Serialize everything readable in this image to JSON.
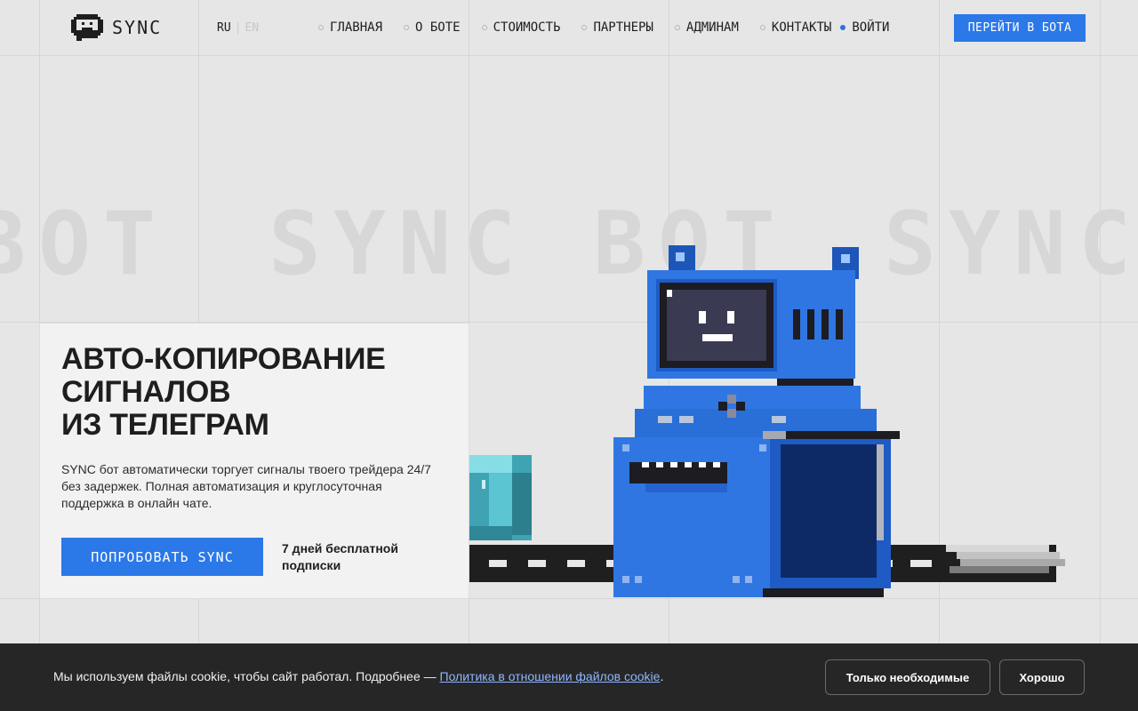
{
  "header": {
    "logo_text": "SYNC",
    "lang": {
      "ru": "RU",
      "separator": "|",
      "en": "EN"
    },
    "nav": [
      {
        "label": "ГЛАВНАЯ",
        "active": false
      },
      {
        "label": "О БОТЕ",
        "active": false
      },
      {
        "label": "СТОИМОСТЬ",
        "active": false
      },
      {
        "label": "ПАРТНЕРЫ",
        "active": false
      },
      {
        "label": "АДМИНАМ",
        "active": false
      },
      {
        "label": "КОНТАКТЫ",
        "active": false
      },
      {
        "label": "ВОЙТИ",
        "active": true
      }
    ],
    "cta": "ПЕРЕЙТИ В БОТА"
  },
  "watermark": {
    "text_left": "BOT",
    "text_center": "SYNC BOT",
    "text_right": "SYNC"
  },
  "hero": {
    "title_line1": "АВТО-КОПИРОВАНИЕ",
    "title_line2": "СИГНАЛОВ",
    "title_line3": "ИЗ ТЕЛЕГРАМ",
    "description": "SYNC бот автоматически торгует сигналы твоего трейдера 24/7 без задержек. Полная автоматизация и круглосуточная поддержка в онлайн чате.",
    "try_button": "ПОПРОБОВАТЬ SYNC",
    "trial_note": "7 дней бесплатной подписки"
  },
  "cookie": {
    "text": "Мы используем файлы cookie, чтобы сайт работал. Подробнее — ",
    "link": "Политика в отношении файлов cookie",
    "text_end": ".",
    "btn_necessary": "Только необходимые",
    "btn_ok": "Хорошо"
  },
  "colors": {
    "accent": "#2b78e8",
    "robot_blue": "#2f76e2",
    "cookie_bg": "#262626",
    "page_bg": "#e6e6e6"
  }
}
